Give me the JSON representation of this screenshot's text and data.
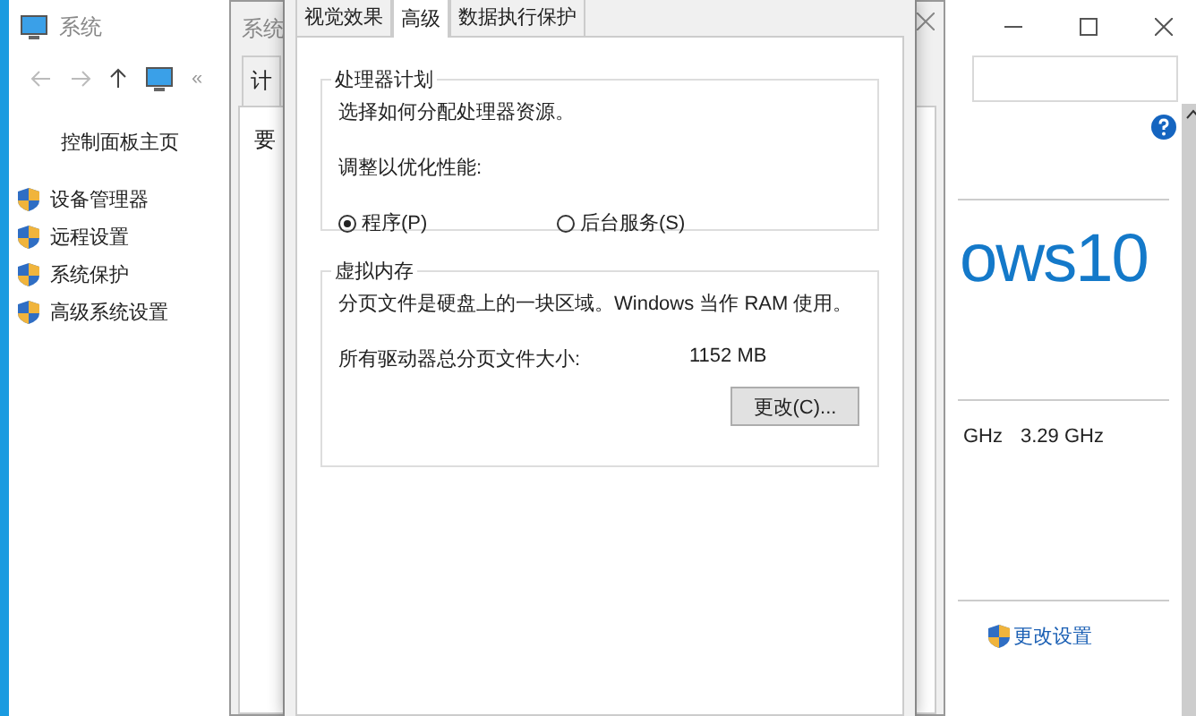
{
  "back_window": {
    "title": "系统",
    "address_marker": "«",
    "sidebar": {
      "home": "控制面板主页",
      "items": [
        {
          "label": "设备管理器"
        },
        {
          "label": "远程设置"
        },
        {
          "label": "系统保护"
        },
        {
          "label": "高级系统设置"
        }
      ]
    },
    "logo_text": "ows10",
    "processor_speed": [
      "GHz",
      "3.29 GHz"
    ],
    "change_settings": "更改设置"
  },
  "middle_window": {
    "title": "系统",
    "tab": "计",
    "heading": "要"
  },
  "dialog": {
    "tabs": [
      {
        "label": "视觉效果",
        "selected": false
      },
      {
        "label": "高级",
        "selected": true
      },
      {
        "label": "数据执行保护",
        "selected": false
      }
    ],
    "processor_group": {
      "legend": "处理器计划",
      "description": "选择如何分配处理器资源。",
      "adjust_label": "调整以优化性能:",
      "options": [
        {
          "label": "程序(P)",
          "selected": true
        },
        {
          "label": "后台服务(S)",
          "selected": false
        }
      ]
    },
    "memory_group": {
      "legend": "虚拟内存",
      "description": "分页文件是硬盘上的一块区域。Windows 当作 RAM 使用。",
      "size_label": "所有驱动器总分页文件大小:",
      "size_value": "1152 MB",
      "change_button": "更改(C)..."
    }
  }
}
